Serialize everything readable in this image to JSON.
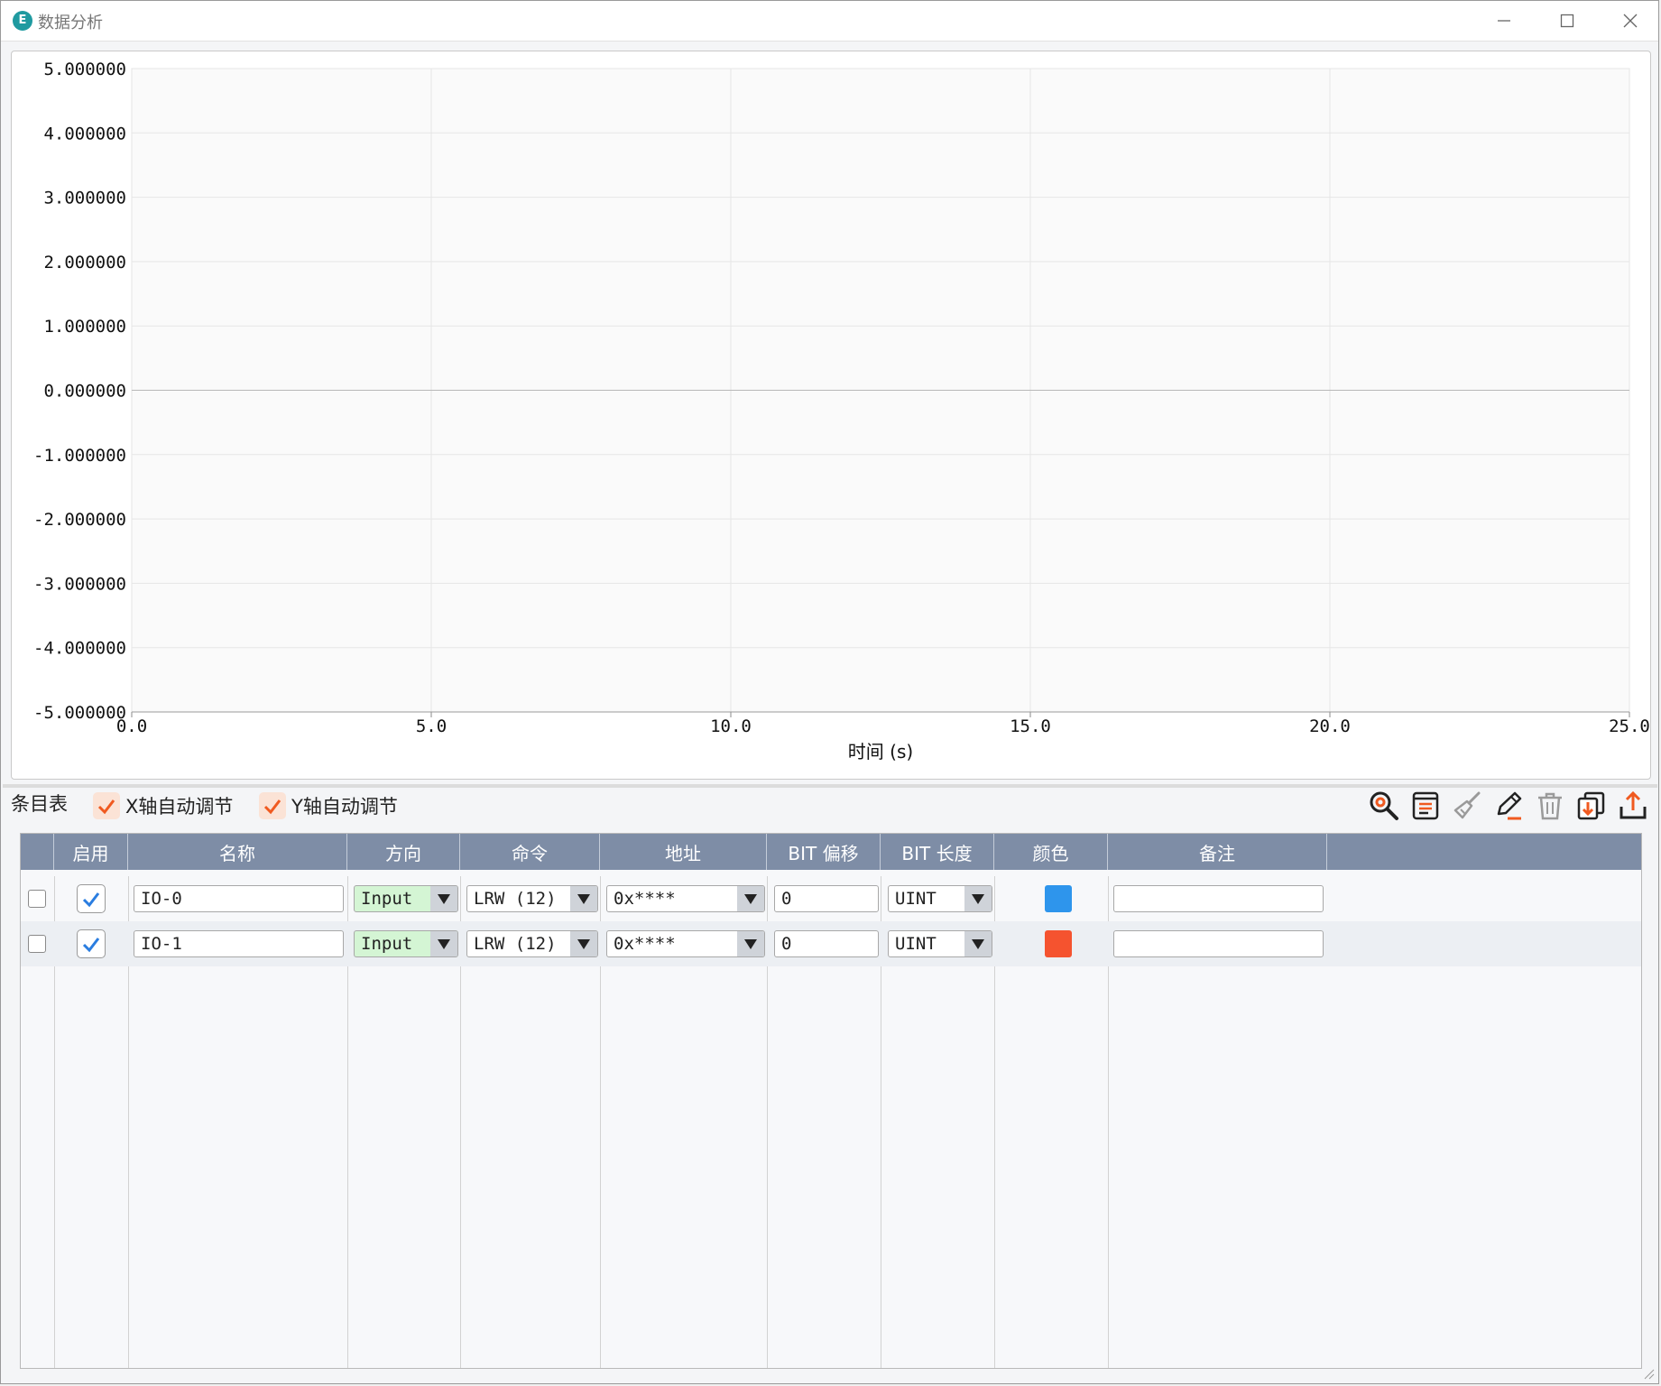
{
  "window": {
    "title": "数据分析",
    "icon": "app-logo-icon",
    "icon_letter": "E"
  },
  "chart_data": {
    "type": "line",
    "title": "",
    "xlabel": "时间 (s)",
    "ylabel": "",
    "xlim": [
      0,
      25
    ],
    "ylim": [
      -5,
      5
    ],
    "x_ticks": [
      "0.0",
      "5.0",
      "10.0",
      "15.0",
      "20.0",
      "25.0"
    ],
    "y_ticks": [
      "5.000000",
      "4.000000",
      "3.000000",
      "2.000000",
      "1.000000",
      "0.000000",
      "-1.000000",
      "-2.000000",
      "-3.000000",
      "-4.000000",
      "-5.000000"
    ],
    "grid": true,
    "series": []
  },
  "entries": {
    "label": "条目表",
    "x_auto": {
      "label": "X轴自动调节",
      "checked": true
    },
    "y_auto": {
      "label": "Y轴自动调节",
      "checked": true
    },
    "toolbar_icons": [
      "search-icon",
      "list-icon",
      "brush-icon",
      "edit-icon",
      "delete-icon",
      "import-icon",
      "export-icon"
    ]
  },
  "grid": {
    "columns": [
      "",
      "启用",
      "名称",
      "方向",
      "命令",
      "地址",
      "BIT 偏移",
      "BIT 长度",
      "颜色",
      "备注"
    ],
    "rows": [
      {
        "selected": false,
        "enabled": true,
        "name": "IO-0",
        "direction": "Input",
        "command": "LRW (12)",
        "address": "0x****",
        "bit_offset": "0",
        "bit_length": "UINT",
        "color": "#2e95ec",
        "note": ""
      },
      {
        "selected": false,
        "enabled": true,
        "name": "IO-1",
        "direction": "Input",
        "command": "LRW (12)",
        "address": "0x****",
        "bit_offset": "0",
        "bit_length": "UINT",
        "color": "#f5532f",
        "note": ""
      }
    ]
  }
}
